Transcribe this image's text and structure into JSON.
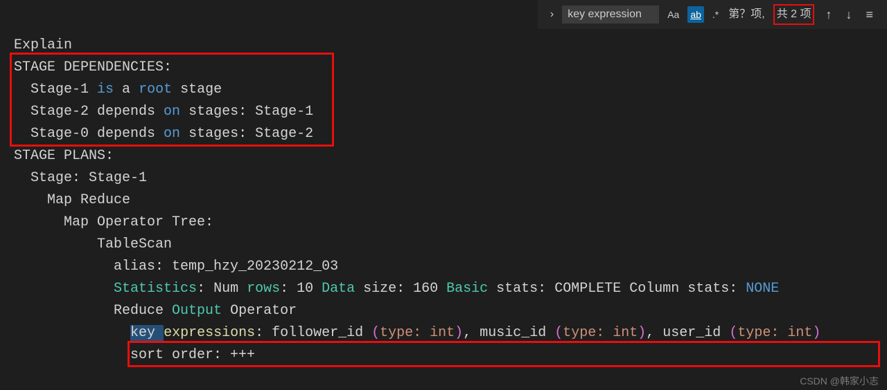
{
  "findbar": {
    "toggle": "›",
    "input_value": "key expression",
    "opt_case": "Aa",
    "opt_word": "ab",
    "opt_regex": ".*",
    "status_prefix": "第？项,",
    "status_total": "共 2 项",
    "arrow_up": "↑",
    "arrow_down": "↓",
    "menu": "≡"
  },
  "code": {
    "explain": "Explain",
    "stage_deps_header": "STAGE DEPENDENCIES:",
    "dep1_a": "  Stage-1 ",
    "dep1_is": "is",
    "dep1_b": " a ",
    "dep1_root": "root",
    "dep1_c": " stage",
    "dep2_a": "  Stage-2 depends ",
    "dep2_on": "on",
    "dep2_b": " stages: Stage-1",
    "dep3_a": "  Stage-0 depends ",
    "dep3_on": "on",
    "dep3_b": " stages: Stage-2",
    "blank": "",
    "plans_header": "STAGE PLANS:",
    "stage1": "  Stage: Stage-1",
    "mr": "    Map Reduce",
    "mot": "      Map Operator Tree:",
    "ts": "          TableScan",
    "alias": "            alias: temp_hzy_20230212_03",
    "stats_a": "            ",
    "stats_stat": "Statistics",
    "stats_b": ": Num ",
    "stats_rows": "rows",
    "stats_c": ": 10 ",
    "stats_data": "Data",
    "stats_d": " size: 160 ",
    "stats_basic": "Basic",
    "stats_e": " stats: COMPLETE Column stats: ",
    "stats_none": "NONE",
    "roo_a": "            Reduce ",
    "roo_out": "Output",
    "roo_b": " Operator",
    "ke_a": "              ",
    "ke_key": "key",
    "ke_sp": " ",
    "ke_expr": "expressions",
    "ke_colon": ": follower_id ",
    "ke_p1o": "(",
    "ke_t1": "type: int",
    "ke_p1c": ")",
    "ke_c1": ", music_id ",
    "ke_p2o": "(",
    "ke_t2": "type: int",
    "ke_p2c": ")",
    "ke_c2": ", user_id ",
    "ke_p3o": "(",
    "ke_t3": "type: int",
    "ke_p3c": ")",
    "sort": "              sort order: +++"
  },
  "watermark": "CSDN @韩家小志"
}
